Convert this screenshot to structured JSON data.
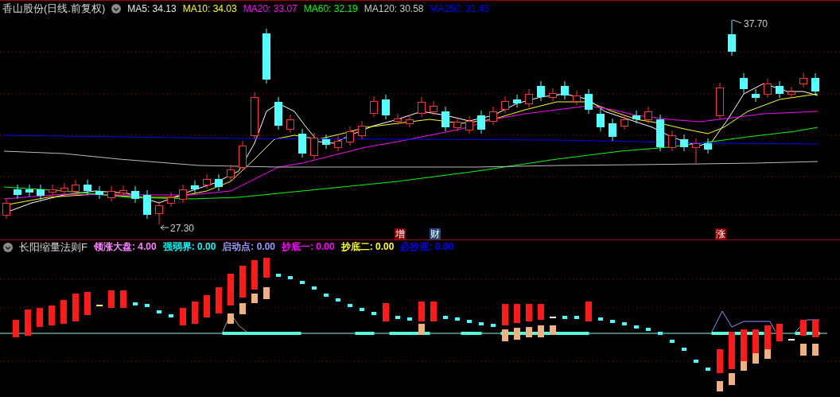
{
  "price_panel": {
    "title": "香山股份(日线.前复权)",
    "indicators": [
      {
        "label": "MA5: 34.13",
        "color": "#e8e8e8"
      },
      {
        "label": "MA10: 34.03",
        "color": "#ffff00"
      },
      {
        "label": "MA20: 33.07",
        "color": "#ff00ff"
      },
      {
        "label": "MA60: 32.19",
        "color": "#00ff00"
      },
      {
        "label": "MA120: 30.58",
        "color": "#c8c8c8"
      },
      {
        "label": "MA250: 31.45",
        "color": "#0000ff"
      }
    ],
    "high_label": "37.70",
    "low_label": "27.30",
    "markers": [
      {
        "text": "增",
        "color": "#8b0000"
      },
      {
        "text": "财",
        "color": "#1c4a80"
      },
      {
        "text": "涨",
        "color": "#8b0000"
      }
    ]
  },
  "indicator_panel": {
    "title": "长阳缩量法则F",
    "values": [
      {
        "label": "领涨大盘: 4.00",
        "color": "#ff80ff"
      },
      {
        "label": "强弱界: 0.00",
        "color": "#00ffff"
      },
      {
        "label": "启动点: 0.00",
        "color": "#9a9aff"
      },
      {
        "label": "抄底一: 0.00",
        "color": "#ff00ff"
      },
      {
        "label": "抄底二: 0.00",
        "color": "#ffff00"
      },
      {
        "label": "必抄底: 0.00",
        "color": "#0000ff"
      }
    ]
  }
}
